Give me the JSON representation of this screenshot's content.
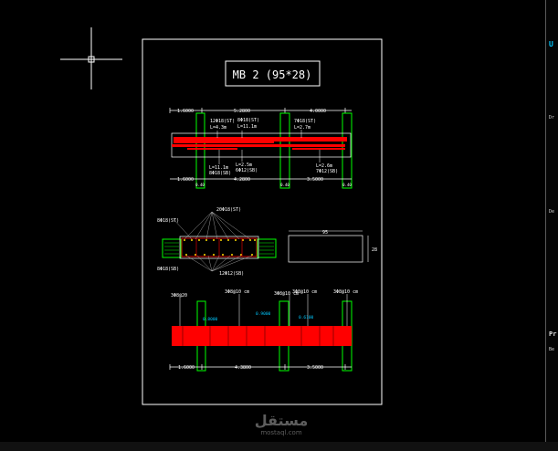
{
  "sheet": {
    "title": "MB 2 (95*28)"
  },
  "elevation": {
    "dim_top": [
      "1.6000",
      "5.2800",
      "4.0000"
    ],
    "dim_bottom": [
      "1.6000",
      "4.2800",
      "3.5000"
    ],
    "small_dims": [
      "0.40",
      "0.40",
      "0.40"
    ],
    "rebar_top": [
      {
        "mark": "12Φ18(ST)",
        "len": "L=4.3m"
      },
      {
        "mark": "8Φ18(ST)",
        "len": "L=11.1m"
      },
      {
        "mark": "7Φ18(ST)",
        "len": "L=2.7m"
      }
    ],
    "rebar_bottom": [
      {
        "len": "L=11.1m",
        "mark": "8Φ18(SB)"
      },
      {
        "len": "L=2.5m",
        "mark": "6Φ12(SB)"
      },
      {
        "len": "L=2.6m",
        "mark": "7Φ12(SB)"
      }
    ]
  },
  "section": {
    "labels_top": [
      "8Φ18(ST)",
      "20Φ18(ST)"
    ],
    "labels_bottom": [
      "8Φ18(SB)",
      "12Φ12(SB)"
    ],
    "beam_width": "95",
    "beam_depth": "28"
  },
  "stirrups": {
    "labels_top": [
      "3Φ8@20",
      "3Φ8@10 cm",
      "3Φ8@10 cm",
      "3Φ8@10 cm",
      "3Φ8@10 cm"
    ],
    "cyan_notes": [
      "0.8000",
      "0.9000",
      "0.6100"
    ],
    "dim_bottom": [
      "1.6000",
      "4.3800",
      "3.5000"
    ]
  },
  "side_panel": {
    "items": [
      "U",
      "Dr",
      "De",
      "Pr",
      "Be"
    ]
  },
  "watermark": {
    "brand": "مستقل",
    "site": "mostaql.com"
  },
  "colors": {
    "background": "#000000",
    "frame": "#ffffff",
    "columns": "#00ff00",
    "beam": "#ff0000",
    "dims": "#ffffff",
    "cyan": "#00c8ff"
  }
}
